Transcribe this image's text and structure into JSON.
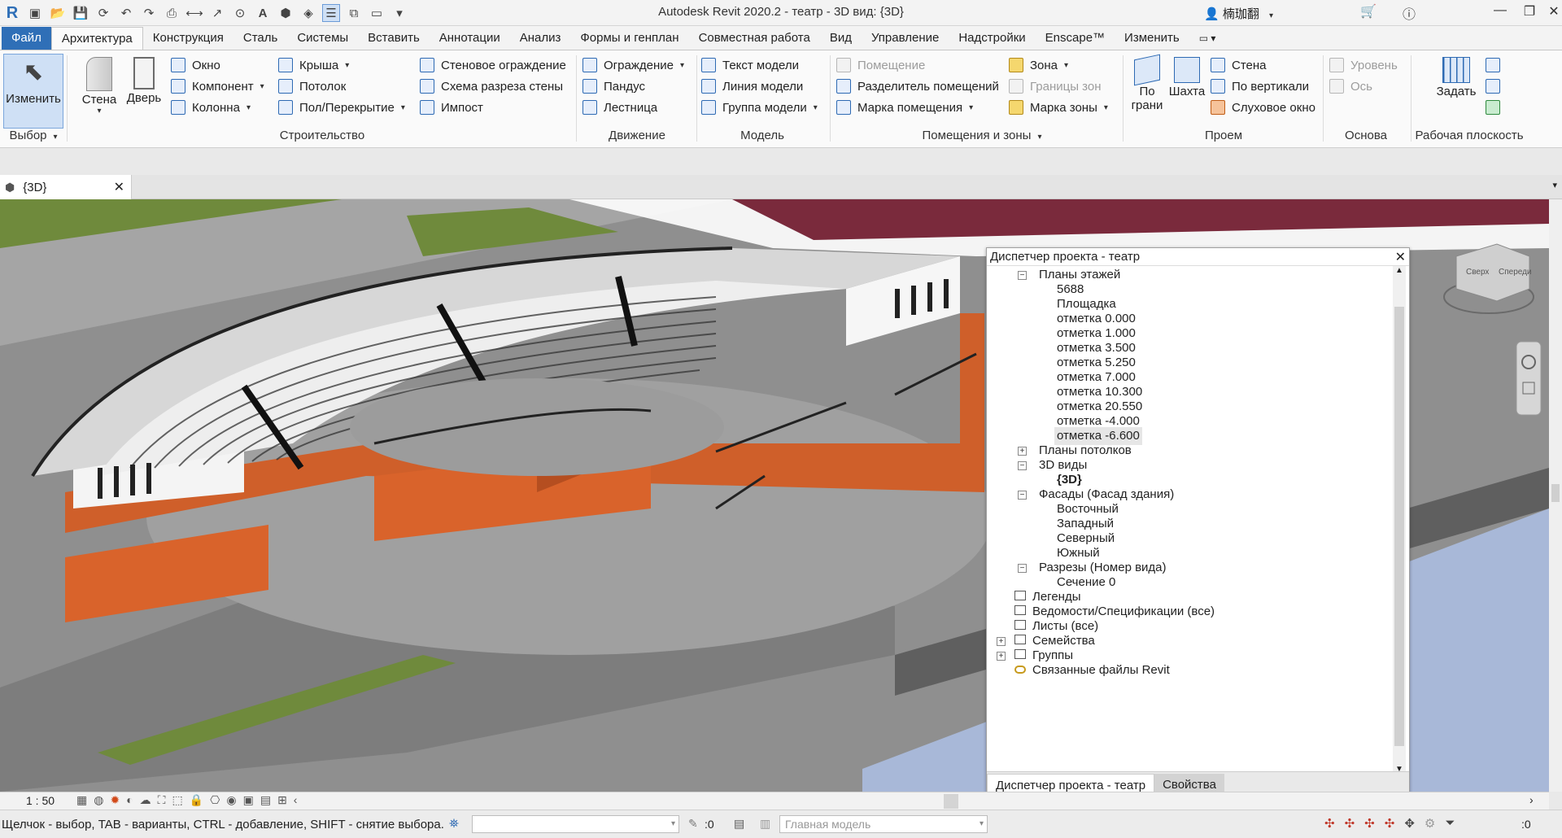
{
  "app": {
    "title": "Autodesk Revit 2020.2 - театр - 3D вид: {3D}",
    "user": "楠珈翻"
  },
  "menu": {
    "tabs": [
      "Файл",
      "Архитектура",
      "Конструкция",
      "Сталь",
      "Системы",
      "Вставить",
      "Аннотации",
      "Анализ",
      "Формы и генплан",
      "Совместная работа",
      "Вид",
      "Управление",
      "Надстройки",
      "Enscape™",
      "Изменить"
    ]
  },
  "ribbon": {
    "select": {
      "modify": "Изменить",
      "title": "Выбор"
    },
    "build": {
      "title": "Строительство",
      "wall": "Стена",
      "door": "Дверь",
      "window": "Окно",
      "component": "Компонент",
      "column": "Колонна",
      "roof": "Крыша",
      "ceiling": "Потолок",
      "floor": "Пол/Перекрытие",
      "curtain_system": "Стеновое ограждение",
      "curtain_grid": "Схема разреза стены",
      "mullion": "Импост"
    },
    "circulation": {
      "title": "Движение",
      "railing": "Ограждение",
      "ramp": "Пандус",
      "stair": "Лестница"
    },
    "model": {
      "title": "Модель",
      "text": "Текст модели",
      "line": "Линия модели",
      "group": "Группа модели"
    },
    "rooms": {
      "title": "Помещения и зоны",
      "room": "Помещение",
      "separator": "Разделитель помещений",
      "tag": "Марка помещения",
      "area": "Зона",
      "boundary": "Границы зон",
      "area_tag": "Марка зоны"
    },
    "opening": {
      "title": "Проем",
      "by_face": "По грани",
      "shaft": "Шахта",
      "wall": "Стена",
      "vertical": "По вертикали",
      "dormer": "Слуховое окно"
    },
    "datum": {
      "title": "Основа",
      "level": "Уровень",
      "grid": "Ось"
    },
    "workplane": {
      "title": "Рабочая плоскость",
      "set": "Задать"
    }
  },
  "view_tab": {
    "label": "{3D}"
  },
  "browser": {
    "title": "Диспетчер проекта - театр",
    "tabs": [
      "Диспетчер проекта - театр",
      "Свойства"
    ],
    "nodes": [
      "Планы этажей",
      "5688",
      "Площадка",
      "отметка 0.000",
      "отметка 1.000",
      "отметка 3.500",
      "отметка 5.250",
      "отметка 7.000",
      "отметка 10.300",
      "отметка 20.550",
      "отметка -4.000",
      "отметка -6.600",
      "Планы потолков",
      "3D виды",
      "{3D}",
      "Фасады (Фасад здания)",
      "Восточный",
      "Западный",
      "Северный",
      "Южный",
      "Разрезы (Номер вида)",
      "Сечение 0",
      "Легенды",
      "Ведомости/Спецификации (все)",
      "Листы (все)",
      "Семейства",
      "Группы",
      "Связанные файлы Revit"
    ]
  },
  "viewcube": {
    "top": "Сверх",
    "front": "Спереди"
  },
  "viewbar": {
    "scale": "1 : 50"
  },
  "status": {
    "hint": "Щелчок - выбор, TAB - варианты, CTRL - добавление, SHIFT - снятие выбора.",
    "count_a": ":0",
    "model": "Главная модель",
    "count_b": ":0"
  },
  "colors": {
    "file_tab": "#2f6fb7",
    "accent": "#2e6ab3",
    "orange_wall": "#d9632b"
  }
}
